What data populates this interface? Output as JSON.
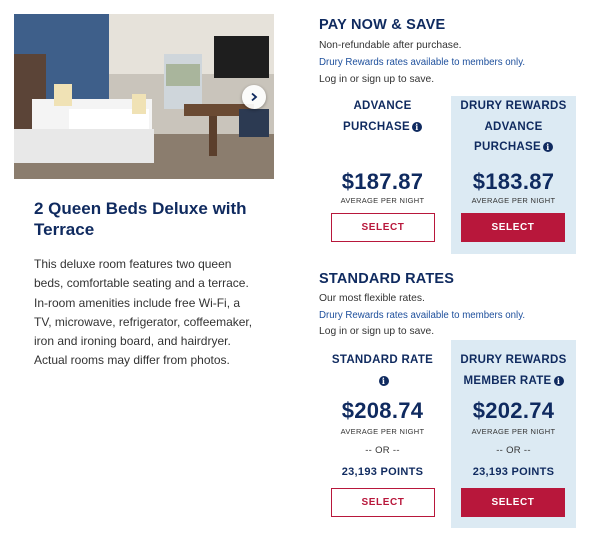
{
  "room": {
    "title": "2 Queen Beds Deluxe with Terrace",
    "description": "This deluxe room features two queen beds, comfortable seating and a terrace. In-room amenities include free Wi-Fi, a TV, microwave, refrigerator, coffeemaker, iron and ironing board, and hairdryer. Actual rooms may differ from photos.",
    "photo_icon": "hotel-room-photo",
    "next_icon": "chevron-right-icon"
  },
  "pay_now": {
    "title": "PAY NOW & SAVE",
    "note": "Non-refundable after purchase.",
    "members_note": "Drury Rewards rates available to members only.",
    "login_note": "Log in or sign up to save.",
    "standard": {
      "heading_line1": "ADVANCE",
      "heading_line2": "PURCHASE",
      "price": "$187.87",
      "per_night": "AVERAGE PER NIGHT",
      "button": "SELECT"
    },
    "member": {
      "heading_line1": "DRURY REWARDS",
      "heading_line2": "ADVANCE",
      "heading_line3": "PURCHASE",
      "price": "$183.87",
      "per_night": "AVERAGE PER NIGHT",
      "button": "SELECT"
    }
  },
  "standard_rates": {
    "title": "STANDARD RATES",
    "note": "Our most flexible rates.",
    "members_note": "Drury Rewards rates available to members only.",
    "login_note": "Log in or sign up to save.",
    "standard": {
      "heading_line1": "STANDARD RATE",
      "price": "$208.74",
      "per_night": "AVERAGE PER NIGHT",
      "or": "-- OR --",
      "points": "23,193 POINTS",
      "button": "SELECT"
    },
    "member": {
      "heading_line1": "DRURY REWARDS",
      "heading_line2": "MEMBER RATE",
      "price": "$202.74",
      "per_night": "AVERAGE PER NIGHT",
      "or": "-- OR --",
      "points": "23,193 POINTS",
      "button": "SELECT"
    }
  },
  "colors": {
    "navy": "#0f2a5f",
    "crimson": "#b8173b",
    "member_bg": "#dceaf3",
    "link_blue": "#1d4f9c"
  }
}
